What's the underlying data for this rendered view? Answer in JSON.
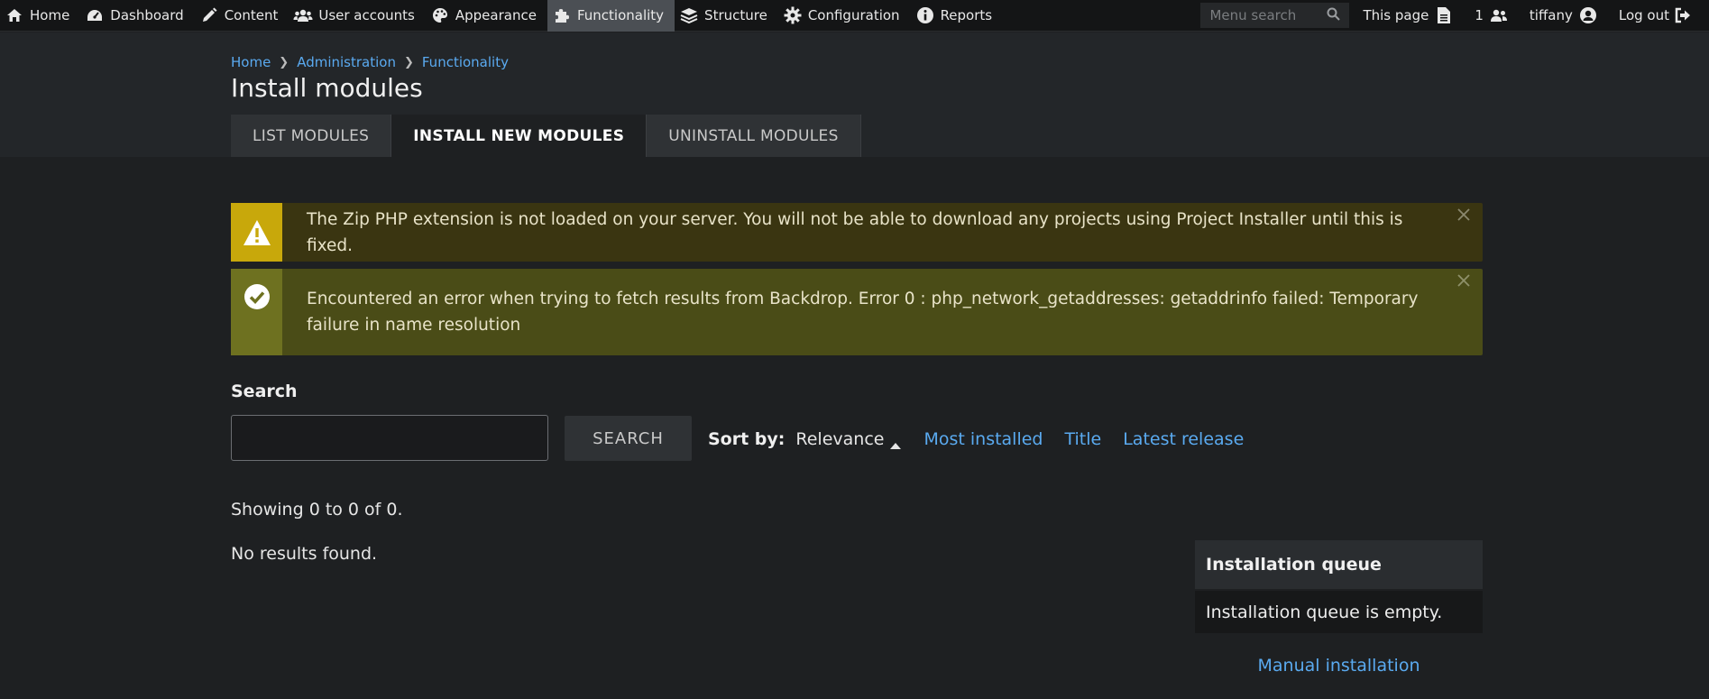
{
  "adminbar": {
    "items": [
      {
        "label": "Home",
        "icon": "home-icon"
      },
      {
        "label": "Dashboard",
        "icon": "dashboard-icon"
      },
      {
        "label": "Content",
        "icon": "pencil-icon"
      },
      {
        "label": "User accounts",
        "icon": "users-icon"
      },
      {
        "label": "Appearance",
        "icon": "palette-icon"
      },
      {
        "label": "Functionality",
        "icon": "puzzle-icon",
        "active": true
      },
      {
        "label": "Structure",
        "icon": "layers-icon"
      },
      {
        "label": "Configuration",
        "icon": "gear-icon"
      },
      {
        "label": "Reports",
        "icon": "info-icon"
      }
    ],
    "menu_search_placeholder": "Menu search",
    "this_page": "This page",
    "users_count": "1",
    "username": "tiffany",
    "logout": "Log out"
  },
  "breadcrumb": [
    "Home",
    "Administration",
    "Functionality"
  ],
  "page_title": "Install modules",
  "tabs": [
    {
      "label": "LIST MODULES",
      "active": false
    },
    {
      "label": "INSTALL NEW MODULES",
      "active": true
    },
    {
      "label": "UNINSTALL MODULES",
      "active": false
    }
  ],
  "messages": {
    "warning": "The Zip PHP extension is not loaded on your server. You will not be able to download any projects using Project Installer until this is fixed.",
    "status": "Encountered an error when trying to fetch results from Backdrop. Error 0 : php_network_getaddresses: getaddrinfo failed: Temporary failure in name resolution"
  },
  "search": {
    "label": "Search",
    "value": "",
    "button": "SEARCH"
  },
  "sort": {
    "label": "Sort by:",
    "current": "Relevance",
    "options": [
      "Most installed",
      "Title",
      "Latest release"
    ]
  },
  "results": {
    "showing": "Showing 0 to 0 of 0.",
    "empty": "No results found."
  },
  "queue": {
    "title": "Installation queue",
    "empty": "Installation queue is empty.",
    "manual_link": "Manual installation"
  },
  "colors": {
    "link": "#5aaaf0",
    "warning_accent": "#c8a80b",
    "status_accent": "#6e7120"
  }
}
